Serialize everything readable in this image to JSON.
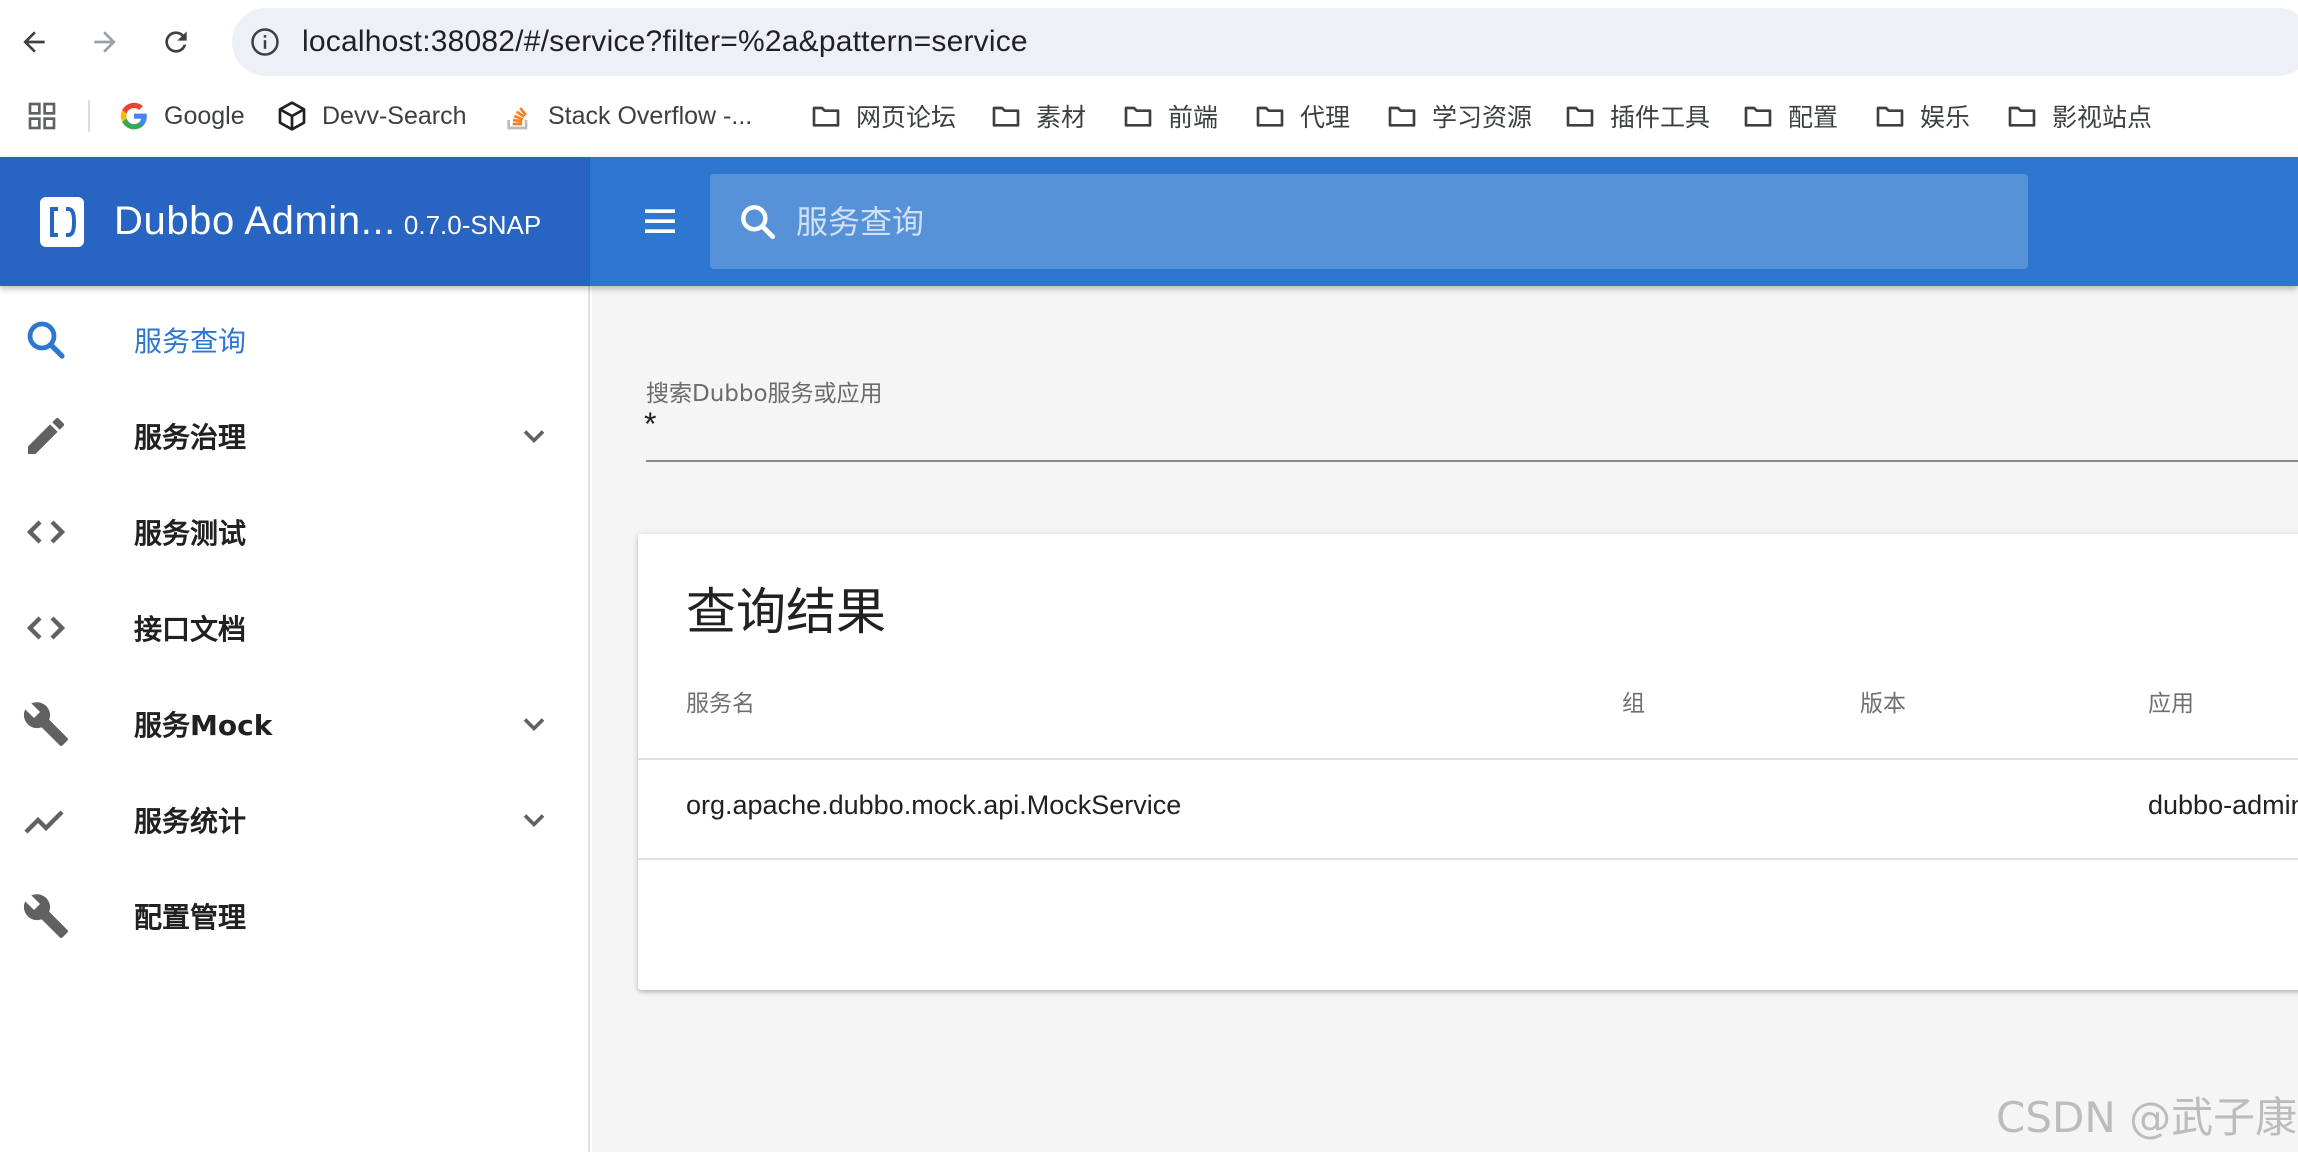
{
  "browser": {
    "url": "localhost:38082/#/service?filter=%2a&pattern=service",
    "bookmarks": [
      {
        "label": "Google",
        "icon": "google-icon"
      },
      {
        "label": "Devv-Search",
        "icon": "cube-icon"
      },
      {
        "label": "Stack Overflow -...",
        "icon": "stackoverflow-icon"
      },
      {
        "label": "网页论坛",
        "icon": "folder-icon"
      },
      {
        "label": "素材",
        "icon": "folder-icon"
      },
      {
        "label": "前端",
        "icon": "folder-icon"
      },
      {
        "label": "代理",
        "icon": "folder-icon"
      },
      {
        "label": "学习资源",
        "icon": "folder-icon"
      },
      {
        "label": "插件工具",
        "icon": "folder-icon"
      },
      {
        "label": "配置",
        "icon": "folder-icon"
      },
      {
        "label": "娱乐",
        "icon": "folder-icon"
      },
      {
        "label": "影视站点",
        "icon": "folder-icon"
      }
    ]
  },
  "app": {
    "title": "Dubbo Admin...",
    "version": "0.7.0-SNAP",
    "search_placeholder": "服务查询",
    "colors": {
      "primary": "#2e77d0",
      "brand_bg": "#2865c2"
    }
  },
  "sidebar": {
    "items": [
      {
        "label": "服务查询",
        "icon": "search-icon",
        "active": true,
        "expandable": false
      },
      {
        "label": "服务治理",
        "icon": "pencil-icon",
        "active": false,
        "expandable": true
      },
      {
        "label": "服务测试",
        "icon": "code-icon",
        "active": false,
        "expandable": false
      },
      {
        "label": "接口文档",
        "icon": "code-icon",
        "active": false,
        "expandable": false
      },
      {
        "label": "服务Mock",
        "icon": "wrench-icon",
        "active": false,
        "expandable": true
      },
      {
        "label": "服务统计",
        "icon": "trending-icon",
        "active": false,
        "expandable": true
      },
      {
        "label": "配置管理",
        "icon": "wrench-icon",
        "active": false,
        "expandable": false
      }
    ]
  },
  "main": {
    "search_field_label": "搜索Dubbo服务或应用",
    "search_field_value": "*",
    "results_title": "查询结果",
    "table": {
      "headers": [
        "服务名",
        "组",
        "版本",
        "应用"
      ],
      "rows": [
        [
          "org.apache.dubbo.mock.api.MockService",
          "",
          "",
          "dubbo-admin"
        ]
      ]
    }
  },
  "watermark": "CSDN @武子康"
}
